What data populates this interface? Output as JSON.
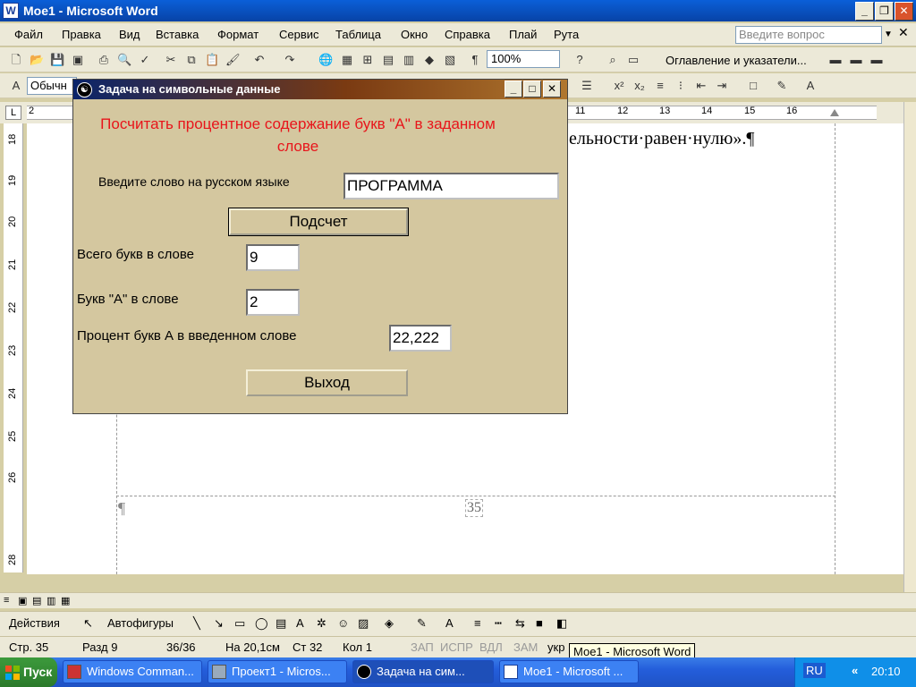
{
  "word": {
    "title": "Мое1 - Microsoft Word",
    "app_icon": "W",
    "menu": [
      "Файл",
      "Правка",
      "Вид",
      "Вставка",
      "Формат",
      "Сервис",
      "Таблица",
      "Окно",
      "Справка",
      "Плай",
      "Рута"
    ],
    "ask_placeholder": "Введите вопрос",
    "zoom": "100%",
    "toc_label": "Оглавление и указатели...",
    "style_value": "Обычн",
    "ruler_numbers": [
      "2",
      "11",
      "12",
      "13",
      "14",
      "15",
      "16"
    ],
    "vruler_numbers": [
      "18",
      "19",
      "20",
      "21",
      "22",
      "23",
      "24",
      "25",
      "26",
      "28"
    ],
    "doc_text": "ельности·равен·нулю».¶",
    "page_number": "35",
    "para_mark": "¶"
  },
  "drawbar": {
    "actions": "Действия",
    "autoshapes": "Автофигуры"
  },
  "status": {
    "page": "Стр. 35",
    "section": "Разд 9",
    "pages": "36/36",
    "at": "На 20,1см",
    "line": "Ст 32",
    "col": "Кол 1",
    "rec": "ЗАП",
    "trk": "ИСПР",
    "ext": "ВДЛ",
    "ovr": "ЗАМ",
    "lang": "укр",
    "tooltip": "Мое1 - Microsoft Word"
  },
  "taskbar": {
    "start": "Пуск",
    "tasks": [
      "Windows Comman...",
      "Проект1 - Micros...",
      "Задача на сим...",
      "Мое1 - Microsoft ..."
    ],
    "lang": "RU",
    "clock": "20:10"
  },
  "dialog": {
    "title": "Задача на символьные данные",
    "heading": "Посчитать процентное содержание букв \"А\" в заданном слове",
    "prompt_label": "Введите слово на русском языке",
    "word_value": "ПРОГРАММА",
    "calc_button": "Подсчет",
    "total_label": "Всего букв в слове",
    "total_value": "9",
    "a_label": "Букв \"А\" в слове",
    "a_value": "2",
    "percent_label": "Процент букв А в введенном слове",
    "percent_value": "22,222",
    "exit_button": "Выход"
  },
  "colors": {
    "dialog_bg": "#d4c79f",
    "heading": "#e8151b",
    "titlebar": "#0a5fd8"
  }
}
